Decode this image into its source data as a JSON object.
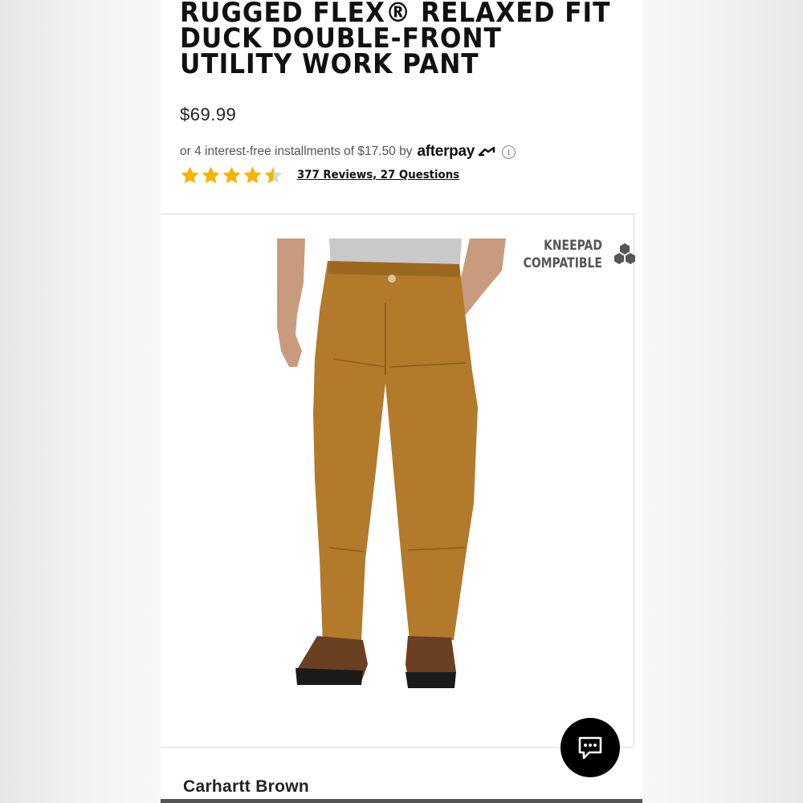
{
  "product": {
    "title_lines": [
      "RUGGED FLEX® RELAXED FIT",
      "DUCK DOUBLE-FRONT",
      "UTILITY WORK PANT"
    ],
    "price": "$69.99",
    "color_name": "Carhartt Brown"
  },
  "afterpay": {
    "text": "or 4 interest-free installments of $17.50 by",
    "logo_text": "afterpay",
    "info_glyph": "i"
  },
  "rating": {
    "stars_value": 4.5,
    "stars_max": 5,
    "reviews_link": "377 Reviews, 27 Questions"
  },
  "badge": {
    "line1": "KNEEPAD",
    "line2": "COMPATIBLE",
    "icon": "hexagon-cluster-icon"
  },
  "chat": {
    "icon": "chat-bubble-icon"
  },
  "colors": {
    "star": "#f6b400",
    "pant": "#b27a2a",
    "text_dark": "#111111",
    "chat_bg": "#000000"
  }
}
